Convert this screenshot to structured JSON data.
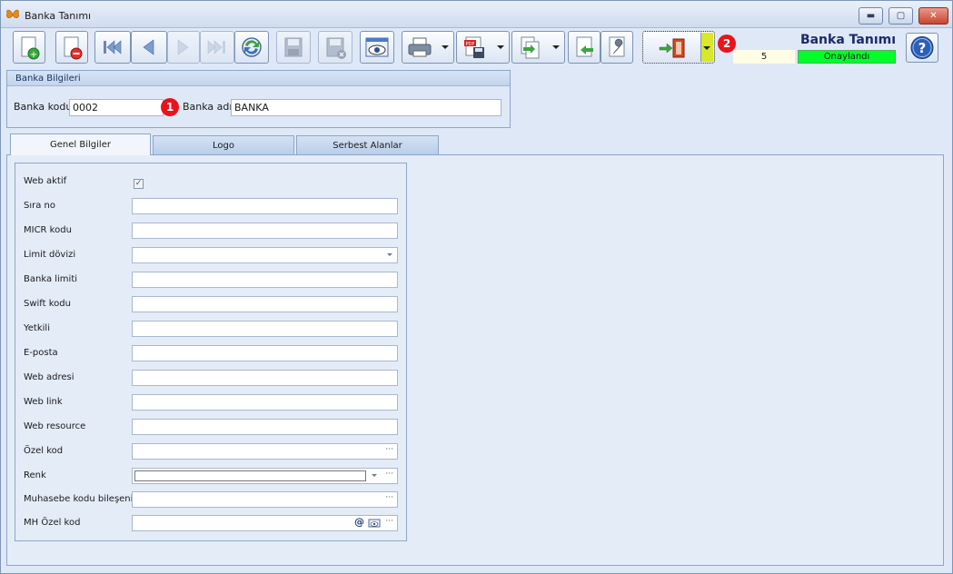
{
  "window": {
    "title": "Banka Tanımı"
  },
  "header": {
    "form_title": "Banka Tanımı",
    "record_no": "5",
    "status": "Onaylandı",
    "status_color": "#00ff2a"
  },
  "annotations": [
    "1",
    "2"
  ],
  "toolbar": {
    "icons": [
      "new-record-icon",
      "delete-record-icon",
      "first-record-icon",
      "previous-record-icon",
      "next-record-icon",
      "last-record-icon",
      "refresh-icon",
      "save-icon",
      "save-close-icon",
      "preview-icon",
      "print-icon",
      "pdf-icon",
      "export-icon",
      "import-icon",
      "settings-icon",
      "exit-icon",
      "help-icon"
    ]
  },
  "bank_info": {
    "group_title": "Banka Bilgileri",
    "code_label": "Banka kodu",
    "code_value": "0002",
    "name_label": "Banka adı",
    "name_value": "BANKA"
  },
  "tabs": [
    {
      "label": "Genel Bilgiler"
    },
    {
      "label": "Logo"
    },
    {
      "label": "Serbest Alanlar"
    }
  ],
  "fields": [
    {
      "label": "Web aktif",
      "value": ""
    },
    {
      "label": "Sıra no",
      "value": ""
    },
    {
      "label": "MICR kodu",
      "value": ""
    },
    {
      "label": "Limit dövizi",
      "value": ""
    },
    {
      "label": "Banka limiti",
      "value": ""
    },
    {
      "label": "Swift kodu",
      "value": ""
    },
    {
      "label": "Yetkili",
      "value": ""
    },
    {
      "label": "E-posta",
      "value": ""
    },
    {
      "label": "Web adresi",
      "value": ""
    },
    {
      "label": "Web link",
      "value": ""
    },
    {
      "label": "Web resource",
      "value": ""
    },
    {
      "label": "Özel kod",
      "value": ""
    },
    {
      "label": "Renk",
      "value": ""
    },
    {
      "label": "Muhasebe kodu bileşeni",
      "value": ""
    },
    {
      "label": "MH Özel kod",
      "value": ""
    }
  ]
}
